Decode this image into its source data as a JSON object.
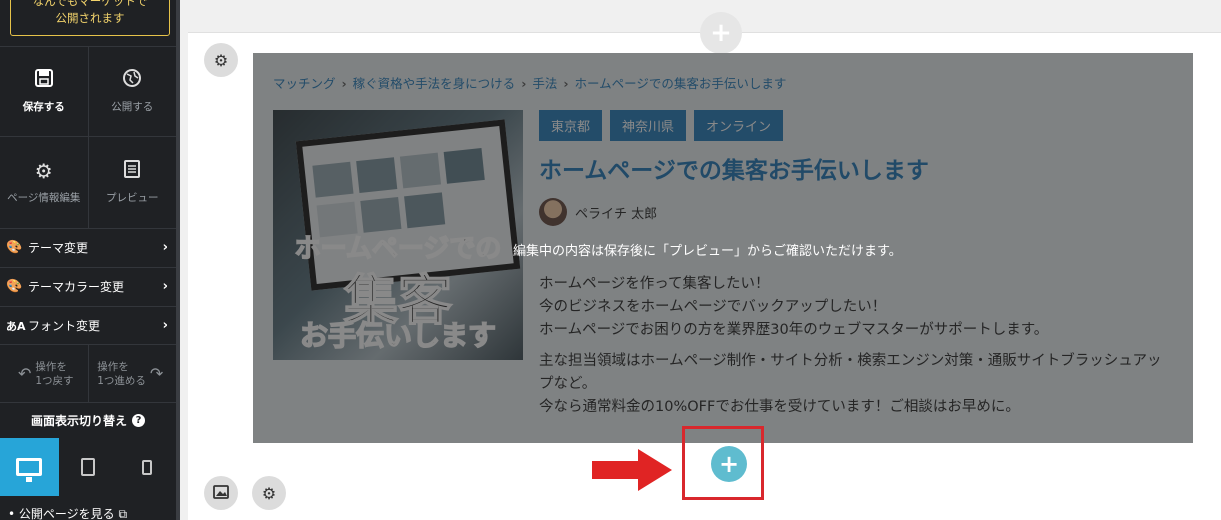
{
  "sidebar": {
    "publish_note": "なんでもマーケットで\n公開されます",
    "save_label": "保存する",
    "publish_label": "公開する",
    "page_info_label": "ページ情報編集",
    "preview_label": "プレビュー",
    "menu": [
      {
        "label": "テーマ変更"
      },
      {
        "label": "テーマカラー変更"
      },
      {
        "label": "フォント変更"
      }
    ],
    "undo_label": "操作を\n1つ戻す",
    "redo_label": "操作を\n1つ進める",
    "display_switch_label": "画面表示切り替え",
    "public_page_link": "公開ページを見る"
  },
  "content": {
    "breadcrumb": [
      "マッチング",
      "稼ぐ資格や手法を身につける",
      "手法",
      "ホームページでの集客お手伝いします"
    ],
    "thumbnail_text": [
      "ホームページでの",
      "集客",
      "お手伝いします"
    ],
    "tags": [
      "東京都",
      "神奈川県",
      "オンライン"
    ],
    "title": "ホームページでの集客お手伝いします",
    "author": "ペライチ 太郎",
    "editing_note": "編集中の内容は保存後に「プレビュー」からご確認いただけます。",
    "description": [
      "ホームページを作って集客したい！\n今のビジネスをホームページでバックアップしたい！\nホームページでお困りの方を業界歴30年のウェブマスターがサポートします。",
      "主な担当領域はホームページ制作・サイト分析・検索エンジン対策・通販サイトブラッシュアップなど。\n今なら通常料金の10%OFFでお仕事を受けています！ご相談はお早めに。"
    ]
  },
  "colors": {
    "accent": "#27a5d8",
    "title_blue": "#1a73b5",
    "tag_blue": "#1e78b9",
    "highlight_red": "#d9282d",
    "add_button": "#5fbccf"
  }
}
